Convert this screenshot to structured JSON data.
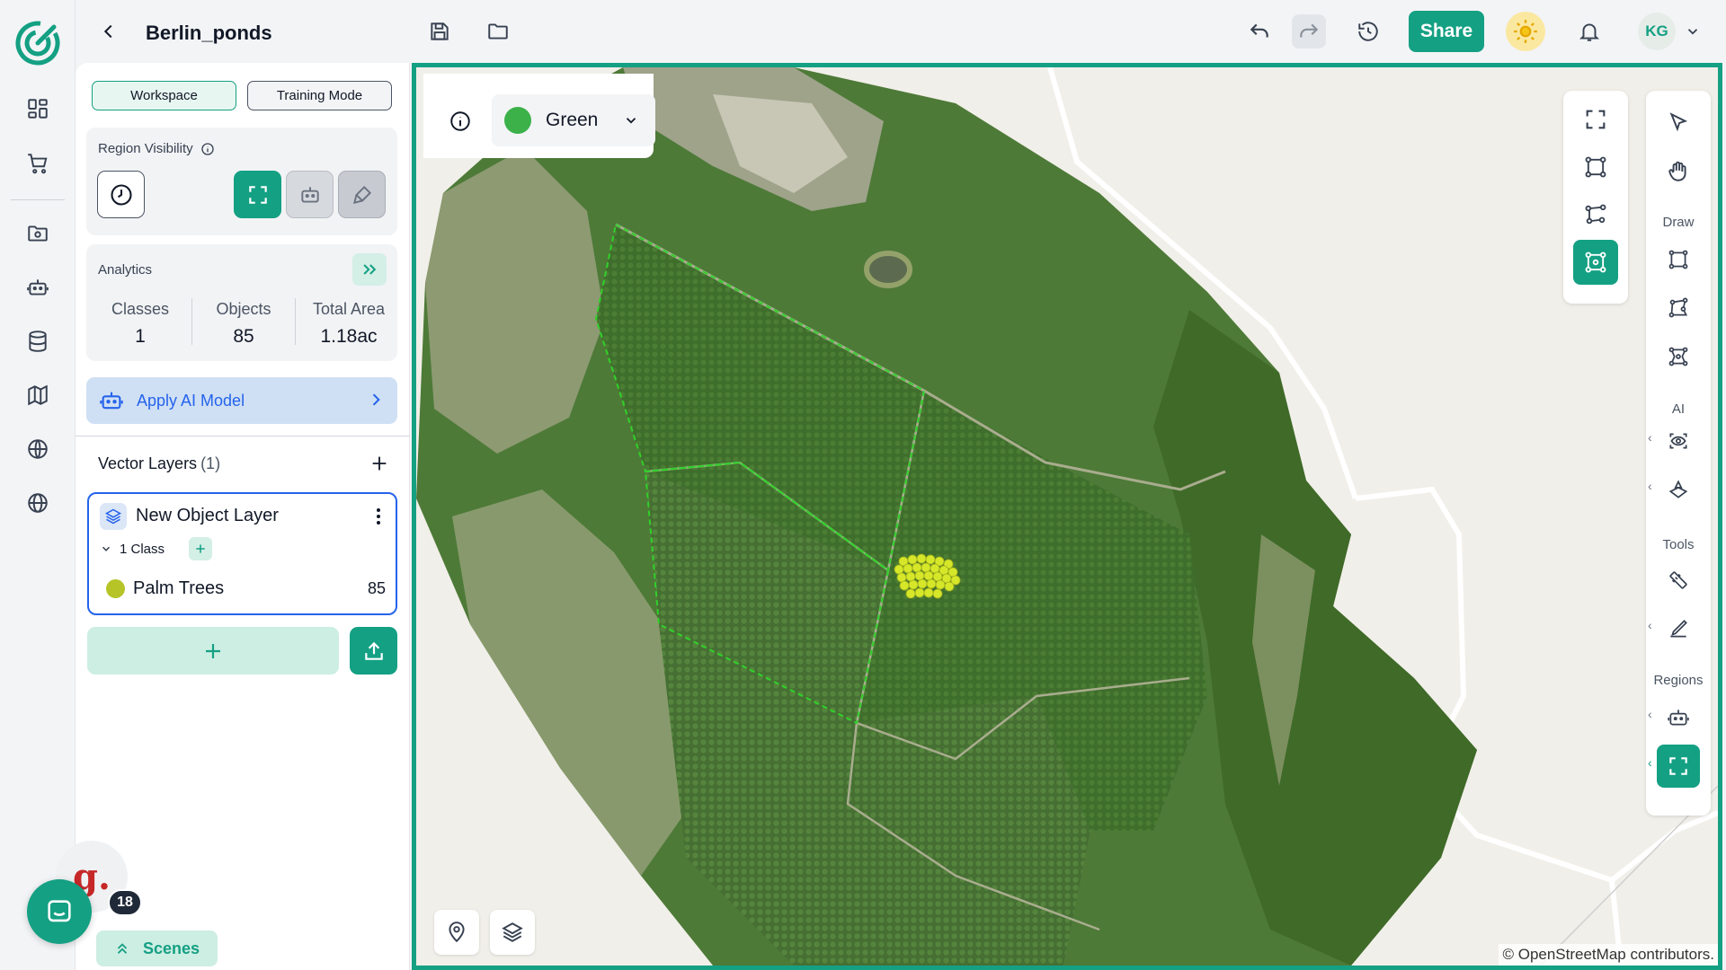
{
  "app": {
    "project_title": "Berlin_ponds",
    "share_label": "Share",
    "user_initials": "KG"
  },
  "panel": {
    "modes": [
      {
        "label": "Workspace",
        "active": true
      },
      {
        "label": "Training Mode",
        "active": false
      }
    ],
    "region_visibility": {
      "title": "Region Visibility"
    },
    "analytics": {
      "title": "Analytics",
      "stats": [
        {
          "label": "Classes",
          "value": "1"
        },
        {
          "label": "Objects",
          "value": "85"
        },
        {
          "label": "Total Area",
          "value": "1.18ac"
        }
      ]
    },
    "ai_model_label": "Apply AI Model",
    "vector_layers": {
      "title": "Vector Layers",
      "count": "(1)",
      "layers": [
        {
          "name": "New Object Layer",
          "class_toggle": "1 Class",
          "classes": [
            {
              "name": "Palm Trees",
              "count": "85",
              "color": "#b7c427"
            }
          ]
        }
      ]
    },
    "scenes_label": "Scenes",
    "notification_count": "18",
    "widget_glyph": "g."
  },
  "map": {
    "color_mode": "Green",
    "color_mode_swatch": "#3cb14a",
    "attribution": "© OpenStreetMap contributors.",
    "toolbar_sections": {
      "draw": "Draw",
      "ai": "AI",
      "tools": "Tools",
      "regions": "Regions"
    }
  },
  "colors": {
    "accent": "#14a083",
    "link_blue": "#2563eb",
    "class_color": "#b7c427"
  }
}
